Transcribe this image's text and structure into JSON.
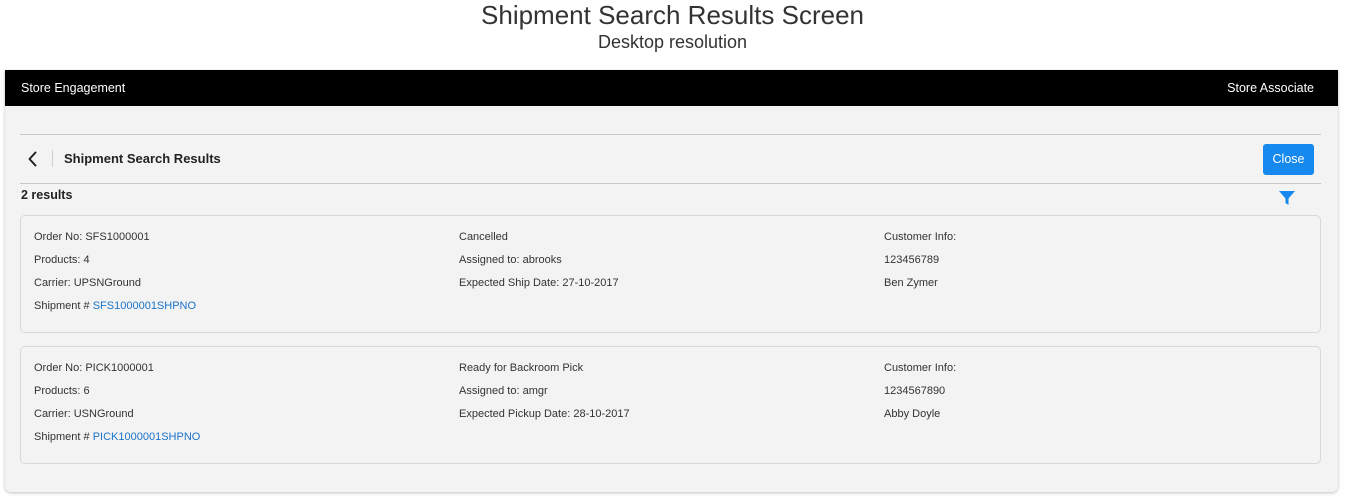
{
  "document": {
    "title": "Shipment Search Results Screen",
    "subtitle": "Desktop resolution"
  },
  "topbar": {
    "app_name": "Store Engagement",
    "user_role": "Store Associate"
  },
  "page": {
    "title": "Shipment Search Results",
    "close_label": "Close",
    "result_count": "2 results"
  },
  "icons": {
    "back": "chevron-left-icon",
    "filter": "filter-icon"
  },
  "colors": {
    "topbar_bg": "#000000",
    "primary_button": "#1589ee",
    "link": "#1a73c9",
    "filter_icon": "#1589ee"
  },
  "results": [
    {
      "order_no": "Order No: SFS1000001",
      "products": "Products: 4",
      "carrier": "Carrier: UPSNGround",
      "shipment_prefix": "Shipment #",
      "shipment_no": "SFS1000001SHPNO",
      "status": "Cancelled",
      "assigned_to": "Assigned to: abrooks",
      "expected_date": "Expected Ship Date: 27-10-2017",
      "customer_label": "Customer Info:",
      "customer_phone": "123456789",
      "customer_name": "Ben Zymer"
    },
    {
      "order_no": "Order No: PICK1000001",
      "products": "Products: 6",
      "carrier": "Carrier: USNGround",
      "shipment_prefix": "Shipment #",
      "shipment_no": "PICK1000001SHPNO",
      "status": "Ready for Backroom Pick",
      "assigned_to": "Assigned to: amgr",
      "expected_date": "Expected Pickup Date: 28-10-2017",
      "customer_label": "Customer Info:",
      "customer_phone": "1234567890",
      "customer_name": "Abby Doyle"
    }
  ]
}
